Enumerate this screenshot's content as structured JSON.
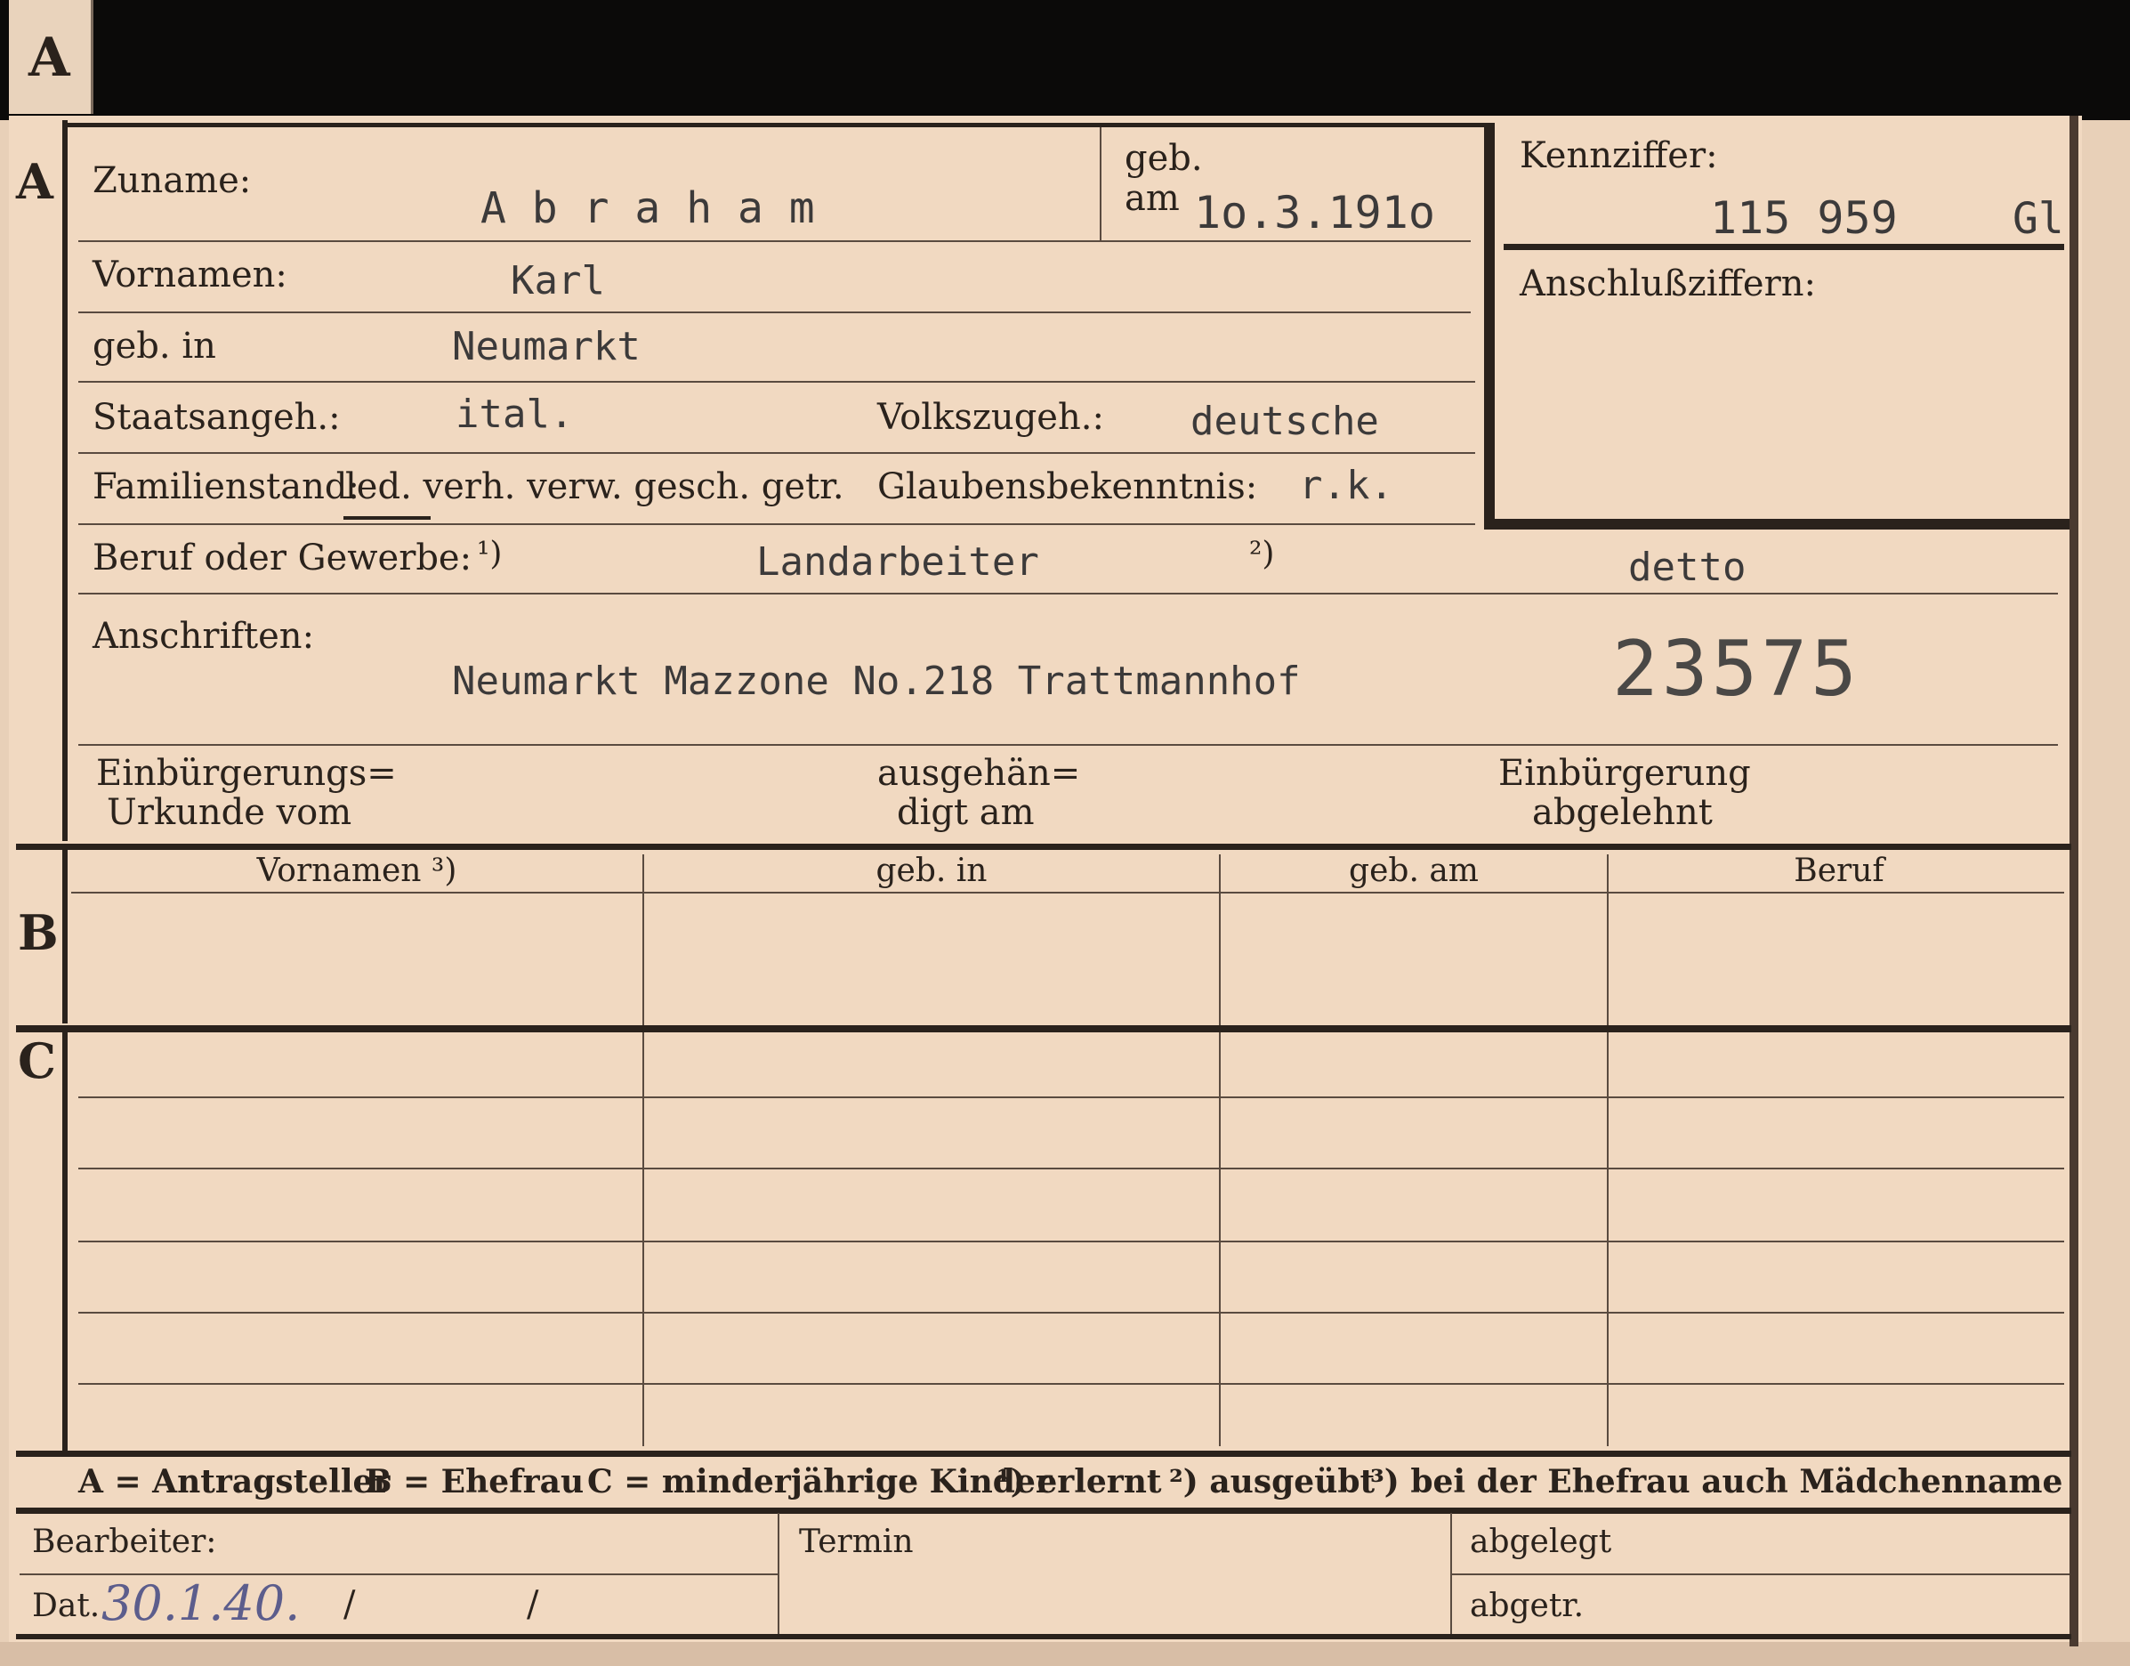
{
  "tab_letter": "A",
  "sections": {
    "a": "A",
    "b": "B",
    "c": "C"
  },
  "labels": {
    "zuname": "Zuname:",
    "geb": "geb.",
    "am": "am",
    "kennziffer": "Kennziffer:",
    "vornamen": "Vornamen:",
    "anschlussziffern": "Anschlußziffern:",
    "geb_in": "geb. in",
    "staatsangeh": "Staatsangeh.:",
    "volkszugeh": "Volkszugeh.:",
    "familienstand": "Familienstand:",
    "familienstand_options": "led. verh. verw. gesch. getr.",
    "glaubensbekenntnis": "Glaubensbekenntnis:",
    "beruf": "Beruf oder Gewerbe:",
    "note1": "¹)",
    "note2": "²)",
    "anschriften": "Anschriften:",
    "einbuergerung_urkunde_1": "Einbürgerungs=",
    "einbuergerung_urkunde_2": "Urkunde vom",
    "ausgehaendigt_1": "ausgehän=",
    "ausgehaendigt_2": "digt am",
    "einbuergerung_abgelehnt_1": "Einbürgerung",
    "einbuergerung_abgelehnt_2": "abgelehnt"
  },
  "values": {
    "zuname": "A b r a h a m",
    "geb_am": "1o.3.191o",
    "kennziffer": "115 959",
    "kennziffer_suffix": "Gl",
    "vornamen": "Karl",
    "geb_in": "Neumarkt",
    "staatsangeh": "ital.",
    "volkszugeh": "deutsche",
    "glaubensbekenntnis": "r.k.",
    "beruf_erlernt": "Landarbeiter",
    "beruf_ausgeuebt": "detto",
    "anschrift": "Neumarkt Mazzone No.218 Trattmannhof",
    "stamp_number": "23575"
  },
  "table_headers": [
    "Vornamen ³)",
    "geb. in",
    "geb. am",
    "Beruf"
  ],
  "legend": [
    "A = Antragsteller",
    "B = Ehefrau",
    "C = minderjährige Kinder",
    "¹) erlernt",
    "²) ausgeübt",
    "³) bei der Ehefrau auch Mädchenname"
  ],
  "footer": {
    "bearbeiter": "Bearbeiter:",
    "termin": "Termin",
    "abgelegt": "abgelegt",
    "dat_label": "Dat.",
    "dat_value": "30.1.40.",
    "slash1": "/",
    "slash2": "/",
    "abgetr": "abgetr."
  }
}
